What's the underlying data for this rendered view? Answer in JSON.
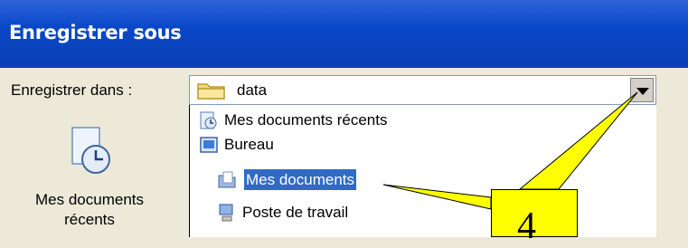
{
  "dialog": {
    "title": "Enregistrer sous"
  },
  "save_in": {
    "label": "Enregistrer dans :",
    "value": "data"
  },
  "dropdown_items": [
    {
      "label": "Mes documents récents",
      "icon": "recent-documents-icon"
    },
    {
      "label": "Bureau",
      "icon": "desktop-icon"
    },
    {
      "label": "Mes documents",
      "icon": "documents-folder-icon",
      "selected": true
    },
    {
      "label": "Poste de travail",
      "icon": "computer-icon"
    }
  ],
  "places_bar": {
    "label": "Mes documents récents",
    "icon": "recent-documents-icon"
  },
  "callout": {
    "text": "4",
    "color": "#ffff00"
  },
  "colors": {
    "title_bar": "#0a48c8",
    "selection": "#316ac5",
    "panel": "#ece9d8"
  }
}
